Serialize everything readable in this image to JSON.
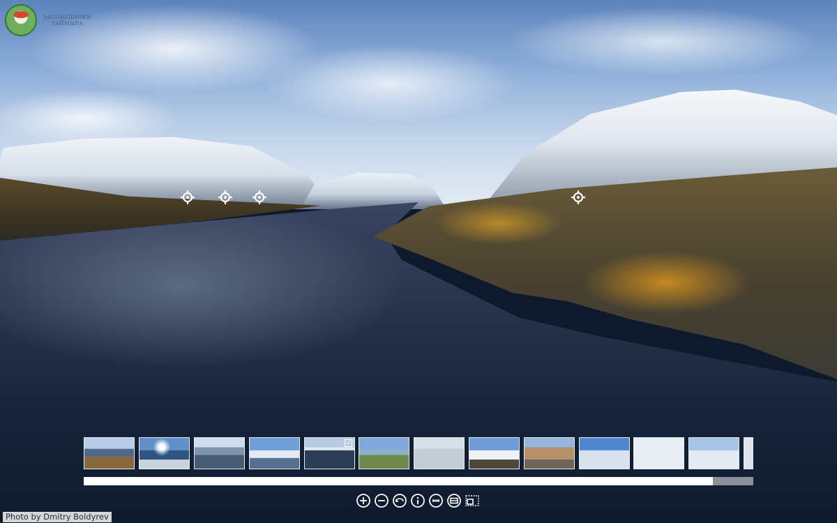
{
  "logo": {
    "icon": "polar-bear-emblem-icon",
    "line1": "ЗАПОВЕДНИКИ",
    "line2": "ТАЙМЫРА"
  },
  "hotspots": [
    {
      "icon": "crosshair-icon"
    },
    {
      "icon": "crosshair-icon"
    },
    {
      "icon": "crosshair-icon"
    },
    {
      "icon": "crosshair-icon"
    }
  ],
  "thumbnails": {
    "count": 13,
    "selected_index": 4,
    "selected_indicator_icon": "checkbox-checked-icon"
  },
  "scroll_progress": 0.94,
  "controls": [
    {
      "name": "zoom-in",
      "icon": "plus-circle-icon"
    },
    {
      "name": "zoom-out",
      "icon": "minus-circle-icon"
    },
    {
      "name": "autorotate",
      "icon": "rotate-icon"
    },
    {
      "name": "info",
      "icon": "info-icon"
    },
    {
      "name": "thumbnails-toggle",
      "icon": "dots-icon"
    },
    {
      "name": "hotspots-toggle",
      "icon": "hotspot-toggle-icon"
    },
    {
      "name": "fullscreen",
      "icon": "fullscreen-icon"
    }
  ],
  "credit": "Photo by Dmitry Boldyrev",
  "colors": {
    "water": "#17243a",
    "sky": "#8fb0da",
    "ui_white": "#ffffff",
    "progress_track": "#8a9099"
  }
}
